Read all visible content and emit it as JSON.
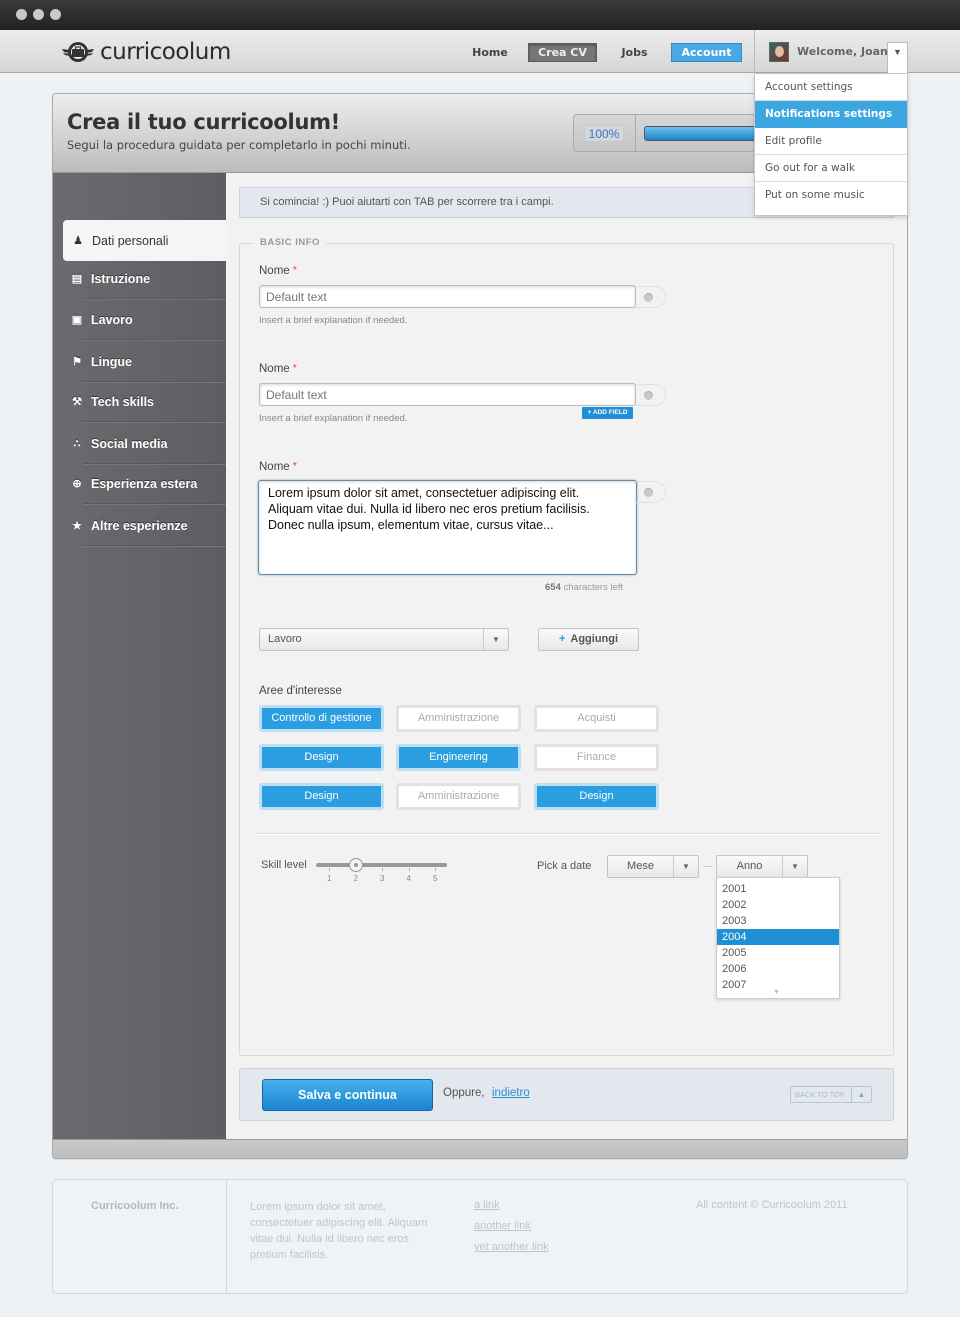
{
  "app": {
    "brand": "curricoolum"
  },
  "nav": {
    "items": [
      {
        "label": "Home"
      },
      {
        "label": "Crea CV"
      },
      {
        "label": "Jobs"
      },
      {
        "label": "Account"
      }
    ],
    "welcome": "Welcome, Joanne"
  },
  "user_menu": {
    "items": [
      {
        "label": "Account settings"
      },
      {
        "label": "Notifications settings",
        "active": true
      },
      {
        "label": "Edit profile"
      },
      {
        "label": "Go out for a walk"
      },
      {
        "label": "Put on some music"
      }
    ]
  },
  "header": {
    "title": "Crea il tuo curricoolum!",
    "subtitle": "Segui la procedura guidata per completarlo in pochi minuti.",
    "progress_label": "100%",
    "progress_value": 100
  },
  "sidebar": {
    "items": [
      {
        "label": "Dati personali",
        "icon": "user-icon",
        "glyph": "♟"
      },
      {
        "label": "Istruzione",
        "icon": "book-icon",
        "glyph": "▤"
      },
      {
        "label": "Lavoro",
        "icon": "briefcase-icon",
        "glyph": "▣"
      },
      {
        "label": "Lingue",
        "icon": "flag-icon",
        "glyph": "⚑"
      },
      {
        "label": "Tech skills",
        "icon": "tools-icon",
        "glyph": "⚒"
      },
      {
        "label": "Social media",
        "icon": "share-icon",
        "glyph": "∴"
      },
      {
        "label": "Esperienza estera",
        "icon": "globe-icon",
        "glyph": "⊕"
      },
      {
        "label": "Altre esperienze",
        "icon": "star-icon",
        "glyph": "★"
      }
    ]
  },
  "form": {
    "intro": "Si comincia! :) Puoi aiutarti con TAB per scorrere tra i campi.",
    "legend": "BASIC INFO",
    "field1": {
      "label": "Nome",
      "required": "*",
      "placeholder": "Default text",
      "help": "Insert a brief explanation if needed."
    },
    "field2": {
      "label": "Nome",
      "required": "*",
      "placeholder": "Default text",
      "help": "Insert a brief explanation if needed.",
      "add_field": "+ ADD FIELD"
    },
    "field3": {
      "label": "Nome",
      "required": "*",
      "value": "Lorem ipsum dolor sit amet, consectetuer adipiscing elit. Aliquam vitae dui. Nulla id libero nec eros pretium facilisis. Donec nulla ipsum, elementum vitae, cursus vitae...",
      "chars_left": "654",
      "chars_left_suffix": "characters left"
    },
    "category_select": {
      "value": "Lavoro"
    },
    "add_button": "Aggiungi",
    "interests": {
      "label": "Aree d'interesse",
      "tags": [
        {
          "label": "Controllo di gestione",
          "selected": true
        },
        {
          "label": "Amministrazione",
          "selected": false
        },
        {
          "label": "Acquisti",
          "selected": false
        },
        {
          "label": "Design",
          "selected": true
        },
        {
          "label": "Engineering",
          "selected": true
        },
        {
          "label": "Finance",
          "selected": false
        },
        {
          "label": "Design",
          "selected": true
        },
        {
          "label": "Amministrazione",
          "selected": false
        },
        {
          "label": "Design",
          "selected": true
        }
      ]
    },
    "skill": {
      "label": "Skill level",
      "value": 2,
      "ticks": [
        "1",
        "2",
        "3",
        "4",
        "5"
      ]
    },
    "date": {
      "label": "Pick a date",
      "month": "Mese",
      "year": "Anno",
      "year_options": [
        "2001",
        "2002",
        "2003",
        "2004",
        "2005",
        "2006",
        "2007"
      ],
      "selected_year": "2004"
    }
  },
  "actions": {
    "save": "Salva e continua",
    "or": "Oppure,",
    "back": "indietro",
    "back_to_top": "BACK TO TOP"
  },
  "footer": {
    "company": "Curricoolum Inc.",
    "text": "Lorem ipsum dolor sit amet, consectetuer adipiscing elit. Aliquam vitae dui. Nulla id libero nec eros pretium facilisis.",
    "links": [
      "a link",
      "another link",
      "yet another link"
    ],
    "copyright": "All content © Curricoolum 2011"
  },
  "colors": {
    "accent": "#2a9ee0",
    "sidebar": "#636367",
    "required": "#ee3333"
  }
}
